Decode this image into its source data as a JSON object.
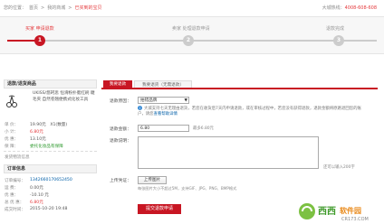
{
  "breadcrumb": {
    "location_label": "您的位置：",
    "home": "首页",
    "sep": ">",
    "my_mall": "我的商城",
    "current": "已买到的宝贝"
  },
  "hotline": {
    "label": "大城热线：",
    "number": "4008-608-608"
  },
  "steps": [
    {
      "num": "1",
      "label": "买家 申请退款",
      "state": "active"
    },
    {
      "num": "2",
      "label": "卖家 处理退款申请",
      "state": "pending"
    },
    {
      "num": "3",
      "label": "退款完成",
      "state": "pending"
    }
  ],
  "left": {
    "goods_title": "退款/退货商品",
    "product_name": "UKISS/悠珂思 恒滑粉扑腮红刷 睫毛夹 自然卷翘便携式化妆工具",
    "rows": [
      {
        "k": "单 价：",
        "v": "19.90元　X1(数量)"
      },
      {
        "k": "小 计：",
        "v": "6.80元"
      },
      {
        "k": "优 惠：",
        "v": "13.10元"
      },
      {
        "k": "保 障：",
        "v": "委托化妆品有保障"
      }
    ],
    "shipping_link": "发货物流信息",
    "order_title": "订单信息",
    "order_rows": [
      {
        "k": "订单编号：",
        "v": "1342660170652450"
      },
      {
        "k": "运 费：",
        "v": "0.00元"
      },
      {
        "k": "优 惠：",
        "v": "-10.10 元"
      },
      {
        "k": "总 优 惠：",
        "v": "6.80元"
      },
      {
        "k": "成交时间：",
        "v": "2015-10-20 19:48"
      }
    ]
  },
  "tabs": [
    "我要退款",
    "我要退货（无需退款）"
  ],
  "form": {
    "reason_label": "退款原因：",
    "reason_value": "拍错品牌",
    "hint_text": "大城支持七天无理由退货，若您在收货后7天内申请退款，或在审核过程中，若您没有获得退款，退款金额将原路退回您的账户，请您",
    "hint_link": "查看帮助详情",
    "amount_label": "退款金额：",
    "amount_value": "6.80",
    "amount_note": "最多6.80元",
    "note_label": "退款说明：",
    "note_counter": "还可以输入200字",
    "upload_label": "上传凭证：",
    "upload_button": "上传图片",
    "upload_note": "每张图片大小不超过5M，支持GIF、JPG、PNG、BMP格式",
    "submit_button": "提交退款申请"
  },
  "watermark": {
    "brand": "西西",
    "site": "软件园",
    "url": "CR173.COM"
  },
  "colors": {
    "accent": "#c81623",
    "link": "#005ea7"
  }
}
